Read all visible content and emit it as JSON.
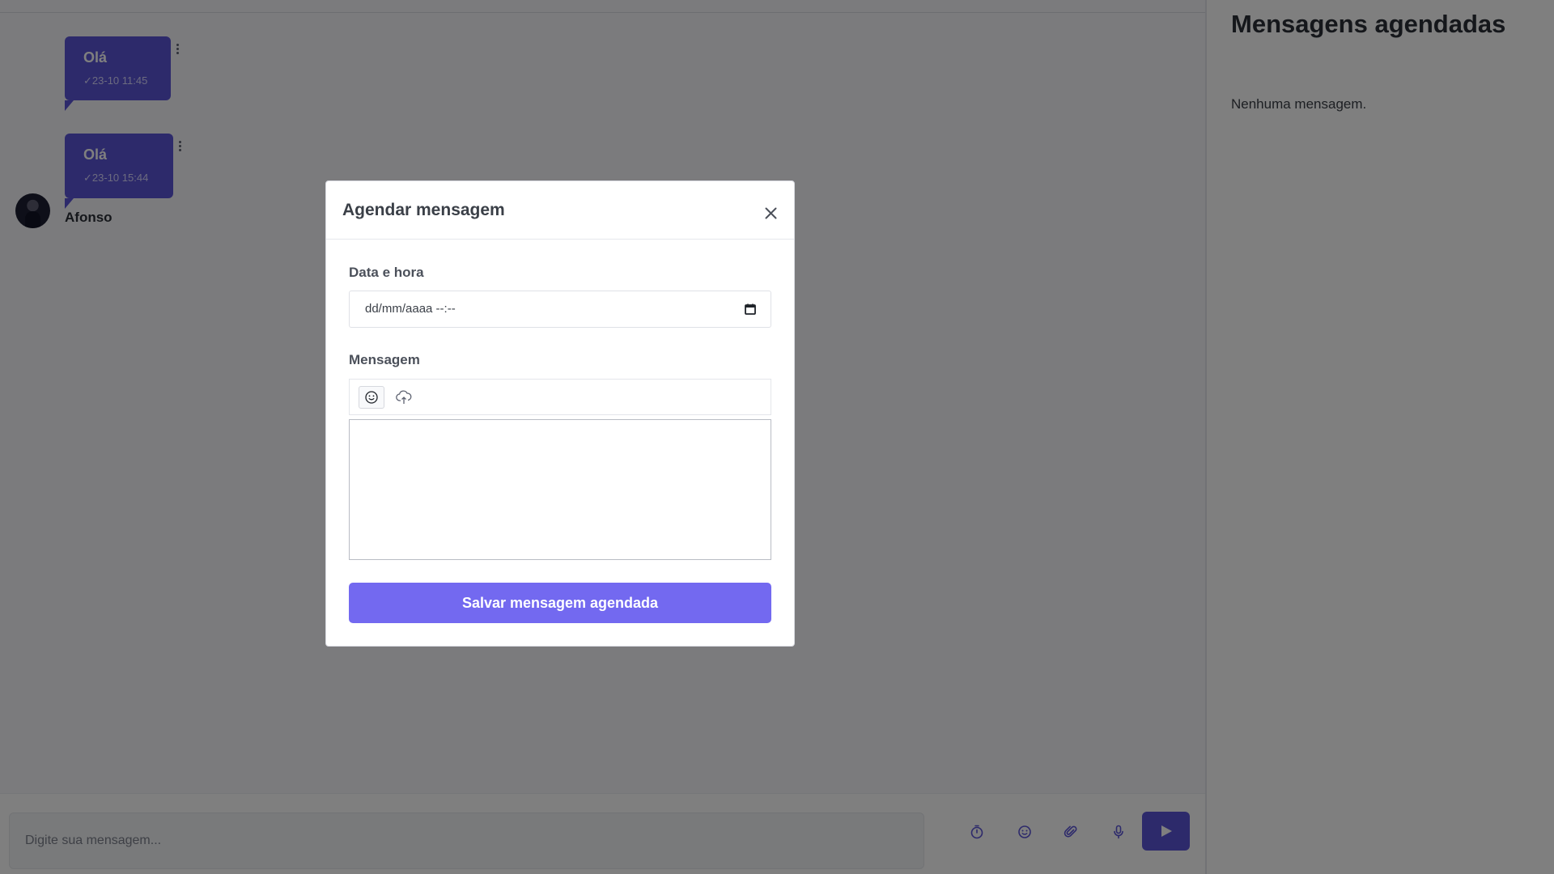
{
  "chat": {
    "messages": [
      {
        "text": "Olá",
        "time": "23-10 11:45",
        "status_icon": "check-icon"
      },
      {
        "text": "Olá",
        "time": "23-10 15:44",
        "status_icon": "check-icon"
      }
    ],
    "sender_name": "Afonso"
  },
  "composer": {
    "placeholder": "Digite sua mensagem...",
    "tools": [
      "timer-icon",
      "smile-icon",
      "paperclip-icon",
      "microphone-icon"
    ],
    "send_icon": "send-icon"
  },
  "sidebar": {
    "title": "Mensagens agendadas",
    "empty_text": "Nenhuma mensagem."
  },
  "modal": {
    "title": "Agendar mensagem",
    "close_icon": "close-icon",
    "date_label": "Data e hora",
    "date_placeholder": "dd/mm/aaaa --:--",
    "message_label": "Mensagem",
    "toolbar_icons": [
      "emoji-icon",
      "cloud-upload-icon"
    ],
    "save_label": "Salvar mensagem agendada"
  },
  "colors": {
    "accent": "#5b54d6",
    "button": "#7369f0",
    "overlay": "rgba(0,0,0,0.5)"
  }
}
